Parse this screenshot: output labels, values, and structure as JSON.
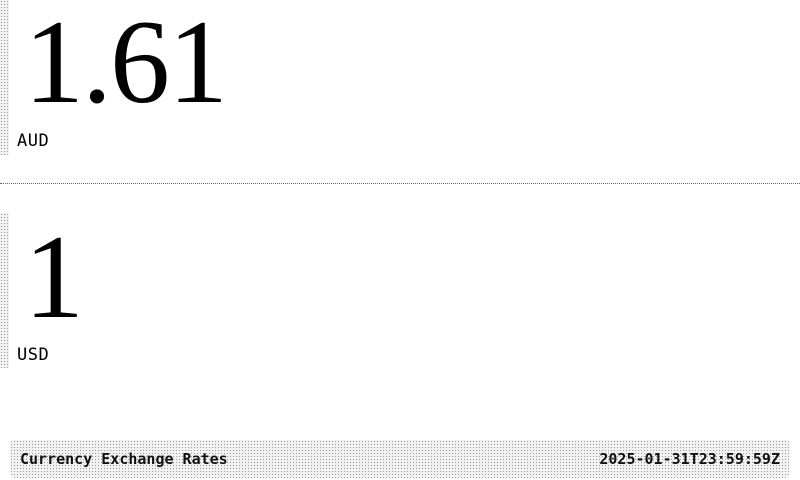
{
  "rates": [
    {
      "value": "1.61",
      "currency": "AUD"
    },
    {
      "value": "1",
      "currency": "USD"
    }
  ],
  "footer": {
    "title": "Currency Exchange Rates",
    "timestamp": "2025-01-31T23:59:59Z"
  },
  "colors": {
    "background": "#ffffff",
    "text": "#000000",
    "dither": "#9a9a9a"
  }
}
